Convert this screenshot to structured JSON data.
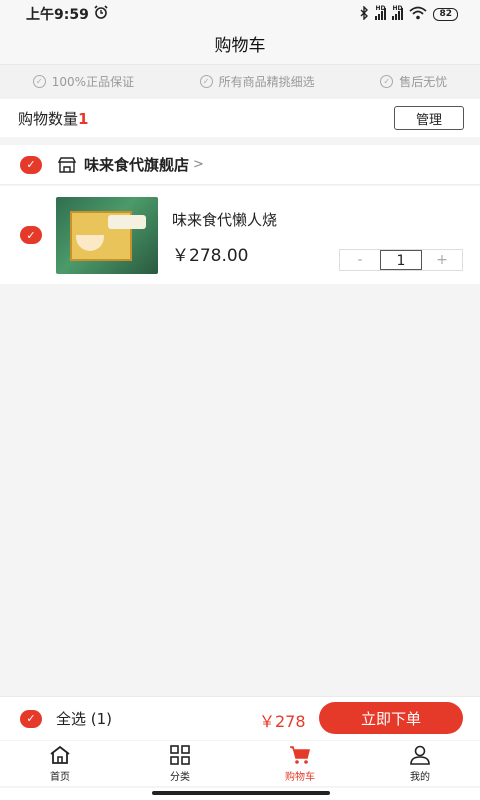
{
  "status": {
    "time": "上午9:59",
    "battery": "82",
    "network_label": "HD"
  },
  "header": {
    "title": "购物车"
  },
  "guarantees": [
    {
      "label": "100%正品保证"
    },
    {
      "label": "所有商品精挑细选"
    },
    {
      "label": "售后无忧"
    }
  ],
  "cart": {
    "count_label": "购物数量",
    "count": "1",
    "manage_label": "管理"
  },
  "store": {
    "name": "味来食代旗舰店",
    "chevron": ">"
  },
  "items": [
    {
      "name": "味来食代懒人烧",
      "price": "￥278.00",
      "quantity": "1",
      "minus": "-",
      "plus": "+"
    }
  ],
  "checkout": {
    "select_all_label": "全选 (1)",
    "total": "￥278",
    "order_label": "立即下单"
  },
  "tabs": [
    {
      "label": "首页",
      "icon": "home-icon"
    },
    {
      "label": "分类",
      "icon": "grid-icon"
    },
    {
      "label": "购物车",
      "icon": "cart-icon"
    },
    {
      "label": "我的",
      "icon": "user-icon"
    }
  ],
  "colors": {
    "accent": "#e53a2a"
  }
}
